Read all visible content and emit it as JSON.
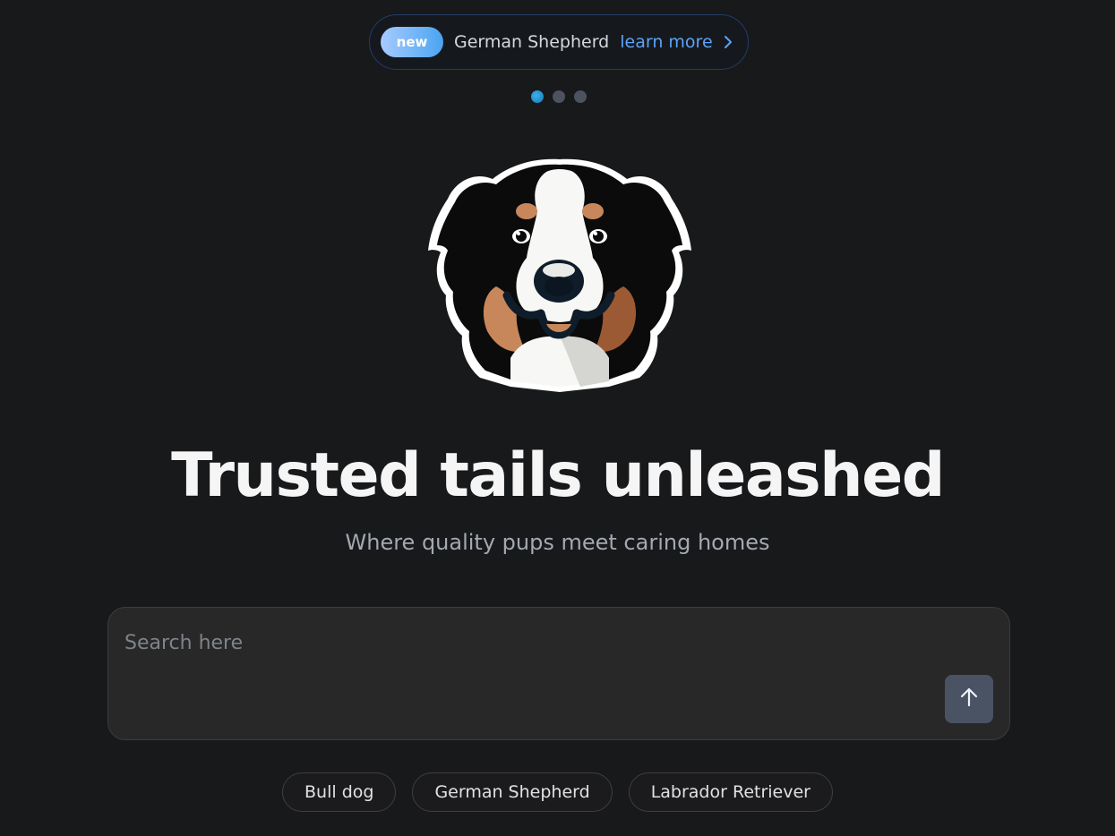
{
  "announcement": {
    "badge": "new",
    "text": "German Shepherd",
    "link": "learn more"
  },
  "carousel": {
    "count": 3,
    "active_index": 0
  },
  "hero": {
    "title": "Trusted tails unleashed",
    "subtitle": "Where quality pups meet caring homes"
  },
  "search": {
    "placeholder": "Search here",
    "value": ""
  },
  "suggestions": [
    {
      "label": "Bull dog"
    },
    {
      "label": "German Shepherd"
    },
    {
      "label": "Labrador Retriever"
    }
  ],
  "colors": {
    "background": "#17191b",
    "accent": "#5ea2f5",
    "badge_gradient_start": "#a7cbff",
    "badge_gradient_end": "#4aa4f1",
    "active_dot": "#2a9ad8",
    "send_button": "#4a5364"
  },
  "icons": {
    "announce_arrow": "chevron-right-icon",
    "send": "arrow-up-icon",
    "logo": "dog-logo-icon"
  }
}
